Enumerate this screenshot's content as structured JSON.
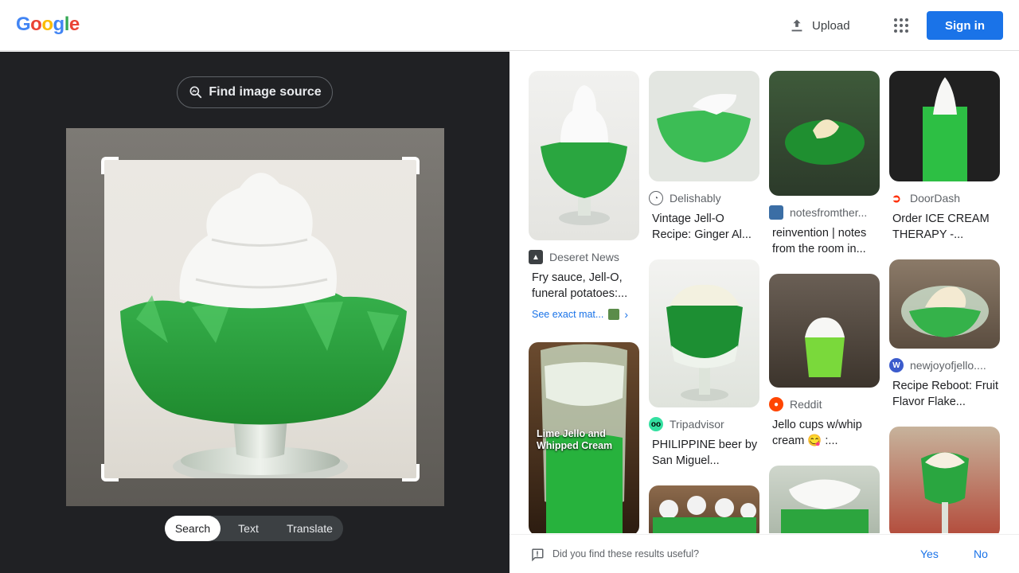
{
  "header": {
    "logo": [
      "G",
      "o",
      "o",
      "g",
      "l",
      "e"
    ],
    "logo_colors": [
      "#4285f4",
      "#ea4335",
      "#fbbc05",
      "#4285f4",
      "#34a853",
      "#ea4335"
    ],
    "upload_label": "Upload",
    "signin_label": "Sign in",
    "apps_icon": "apps-grid-icon"
  },
  "lens": {
    "find_source_label": "Find image source",
    "tabs": [
      {
        "label": "Search",
        "active": true
      },
      {
        "label": "Text",
        "active": false
      },
      {
        "label": "Translate",
        "active": false
      }
    ]
  },
  "results": [
    {
      "source": "Deseret News",
      "title": "Fry sauce, Jell-O, funeral potatoes:...",
      "exact": "See exact mat...",
      "fav_color": "#3c4043"
    },
    {
      "source": "",
      "title": "",
      "overlay": "Lime Jello and Whipped Cream"
    },
    {
      "source": "Delishably",
      "title": "Vintage Jell-O Recipe: Ginger Al...",
      "fav_color": "#5f6368"
    },
    {
      "source": "Tripadvisor",
      "title": "PHILIPPINE beer by San Miguel...",
      "fav_color": "#34e0a1"
    },
    {
      "source": "notesfromther...",
      "title": "reinvention | notes from the room in...",
      "fav_color": "#3b6ea5"
    },
    {
      "source": "Reddit",
      "title": "Jello cups w/whip cream 😋 :...",
      "fav_color": "#ff4500"
    },
    {
      "source": "DoorDash",
      "title": "Order ICE CREAM THERAPY -...",
      "fav_color": "#ff3008"
    },
    {
      "source": "newjoyofjello....",
      "title": "Recipe Reboot: Fruit Flavor Flake...",
      "fav_color": "#3b5bcc"
    }
  ],
  "feedback": {
    "question": "Did you find these results useful?",
    "yes": "Yes",
    "no": "No"
  }
}
